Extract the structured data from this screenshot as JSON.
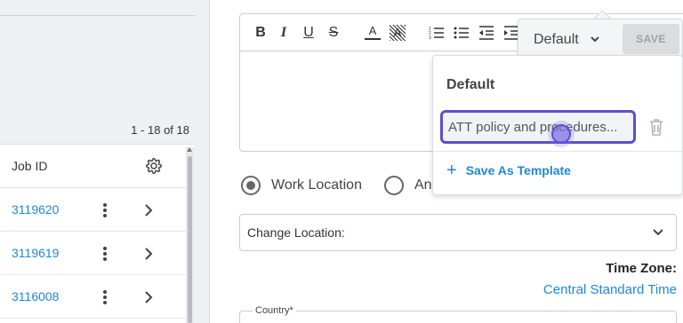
{
  "jobs": {
    "pager_text": "1 - 18 of 18",
    "header": "Job ID",
    "rows": [
      {
        "job_id": "3119620"
      },
      {
        "job_id": "3119619"
      },
      {
        "job_id": "3116008"
      }
    ]
  },
  "editor": {
    "toolbar": [
      "bold",
      "italic",
      "underline",
      "strikethrough",
      "font-color",
      "highlight",
      "ordered-list",
      "bullet-list",
      "outdent",
      "indent"
    ]
  },
  "template": {
    "selected": "Default",
    "save_label": "SAVE",
    "dropdown_title": "Default",
    "name_value": "ATT policy and procedures...",
    "save_as_label": "Save As Template"
  },
  "location": {
    "radio_work": "Work Location",
    "radio_other": "An",
    "change_label": "Change Location:",
    "tz_label": "Time Zone:",
    "tz_value": "Central Standard Time",
    "country_label": "Country*"
  },
  "colors": {
    "accent": "#1e88d8",
    "focus": "#5a4fcf"
  }
}
